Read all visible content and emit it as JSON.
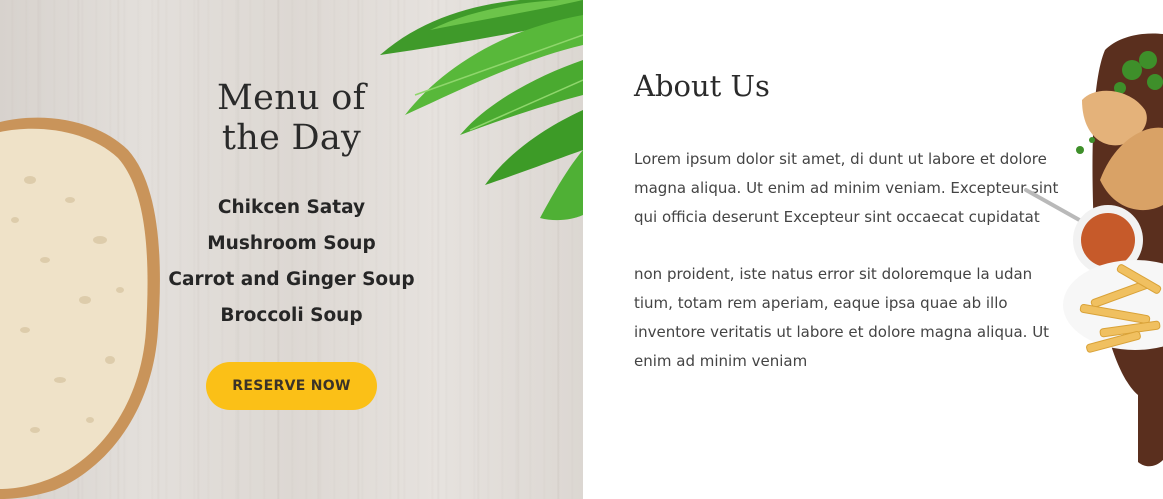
{
  "menu_of_the_day": {
    "title_line1": "Menu of",
    "title_line2": "the Day",
    "items": [
      "Chikcen Satay",
      "Mushroom Soup",
      "Carrot and Ginger Soup",
      "Broccoli Soup"
    ],
    "reserve_button_label": "RESERVE NOW"
  },
  "about": {
    "title": "About Us",
    "paragraphs": [
      "Lorem ipsum dolor sit amet, di dunt ut labore et dolore magna aliqua. Ut enim ad minim veniam. Excepteur sint qui officia deserunt Excepteur sint occaecat cupidatat",
      "non proident, iste natus error sit doloremque la udan tium, totam rem aperiam, eaque ipsa quae ab illo inventore veritatis ut labore et dolore magna aliqua. Ut enim ad minim veniam"
    ]
  },
  "colors": {
    "accent": "#fbc017",
    "text_dark": "#262626",
    "body_text": "#444444",
    "wood_background": "#e0dcd7"
  }
}
